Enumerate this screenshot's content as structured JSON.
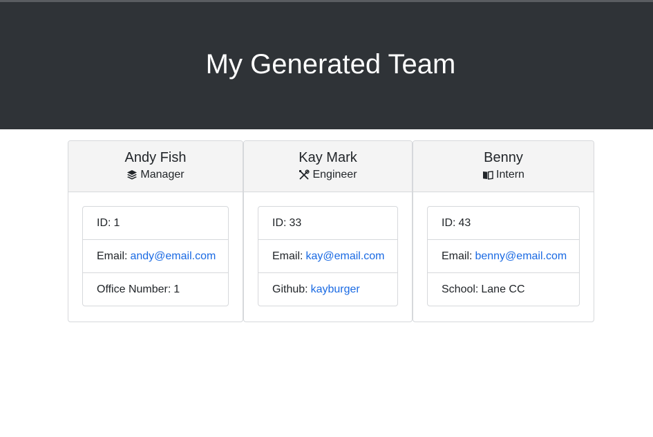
{
  "header": {
    "title": "My Generated Team"
  },
  "team": [
    {
      "name": "Andy Fish",
      "role": "Manager",
      "role_icon": "layers-icon",
      "id_label": "ID:",
      "id_value": "1",
      "email_label": "Email:",
      "email_value": "andy@email.com",
      "extra_label": "Office Number:",
      "extra_value": "1"
    },
    {
      "name": "Kay Mark",
      "role": "Engineer",
      "role_icon": "tools-icon",
      "id_label": "ID:",
      "id_value": "33",
      "email_label": "Email:",
      "email_value": "kay@email.com",
      "extra_label": "Github:",
      "extra_value": "kayburger"
    },
    {
      "name": "Benny",
      "role": "Intern",
      "role_icon": "book-icon",
      "id_label": "ID:",
      "id_value": "43",
      "email_label": "Email:",
      "email_value": "benny@email.com",
      "extra_label": "School:",
      "extra_value": "Lane CC"
    }
  ],
  "colors": {
    "header_bg": "#2f3337",
    "link": "#1a6ae3",
    "card_head_bg": "#f4f4f4"
  }
}
